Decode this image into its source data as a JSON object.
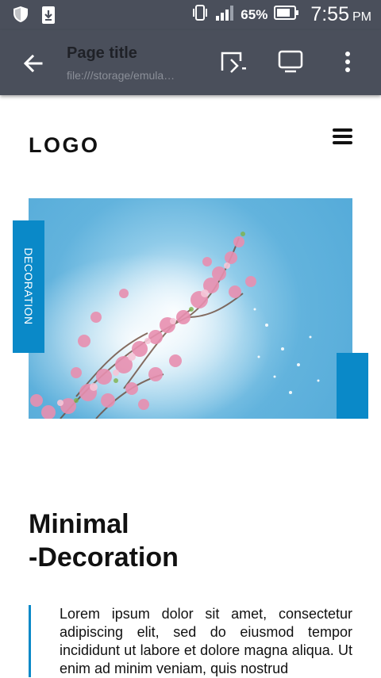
{
  "status_bar": {
    "battery_percent": "65%",
    "time": "7:55",
    "ampm": "PM",
    "icons": [
      "shield-icon",
      "download-icon",
      "vibrate-icon",
      "signal-icon",
      "battery-icon"
    ]
  },
  "app_bar": {
    "title": "Page title",
    "url": "file:///storage/emula…",
    "icons": [
      "back-arrow-icon",
      "cast-icon",
      "desktop-view-icon",
      "more-vert-icon"
    ]
  },
  "site": {
    "logo": "LOGO",
    "decoration_tab": "DECORATION",
    "heading_line1": "Minimal",
    "heading_line2": "-Decoration",
    "quote": "Lorem ipsum dolor sit amet, consectetur adipiscing elit, sed do eiusmod tempor incididunt ut labore et dolore magna aliqua. Ut enim ad minim veniam, quis nostrud"
  },
  "colors": {
    "accent": "#0a89c8",
    "toolbar": "#4a4f5b"
  }
}
